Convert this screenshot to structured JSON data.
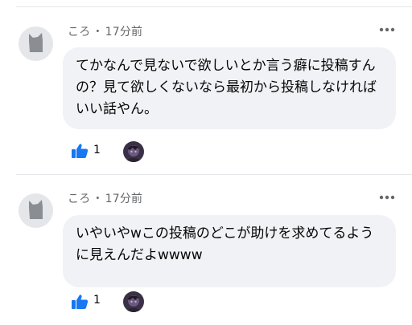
{
  "comments": [
    {
      "author": "ころ",
      "separator": "・",
      "time": "17分前",
      "text": "てかなんで見ないで欲しいとか言う癖に投稿すんの？見て欲しくないなら最初から投稿しなければいい話やん。",
      "like_count": "1"
    },
    {
      "author": "ころ",
      "separator": "・",
      "time": "17分前",
      "text": "いやいやwこの投稿のどこが助けを求めてるように見えんだよwwww",
      "like_count": "1"
    }
  ],
  "icons": {
    "avatar": "cat-silhouette-icon",
    "more": "more-options-icon",
    "like": "thumbs-up-icon",
    "reactor": "user-avatar"
  },
  "colors": {
    "bubble_bg": "#f0f2f5",
    "meta_text": "#65676b",
    "like_blue": "#1877f2",
    "avatar_bg": "#e4e6ea"
  }
}
